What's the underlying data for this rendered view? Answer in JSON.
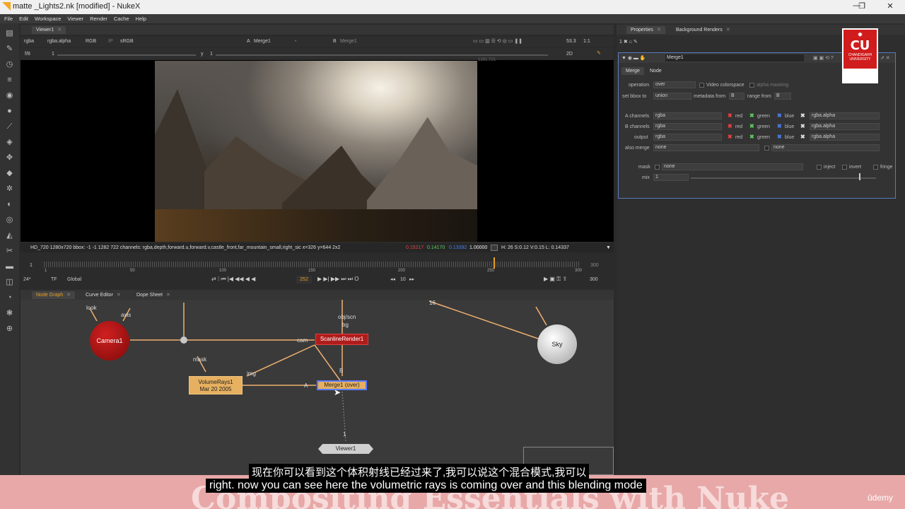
{
  "window": {
    "title": "matte _Lights2.nk [modified] - NukeX",
    "controls": [
      "—",
      "❐",
      "✕"
    ]
  },
  "menubar": [
    "File",
    "Edit",
    "Workspace",
    "Viewer",
    "Render",
    "Cache",
    "Help"
  ],
  "viewer": {
    "tab": "Viewer1",
    "channels": "rgba",
    "alpha": "rgba.alpha",
    "colorspace_mode": "RGB",
    "ip": "IP",
    "lut": "sRGB",
    "a_label": "A",
    "a_input": "Merge1",
    "a_op": "-",
    "b_label": "B",
    "b_input": "Merge1",
    "zoom": "53.3",
    "ratio": "1:1",
    "fstop": "f/8",
    "gain": "1",
    "y_label": "y",
    "gamma": "1",
    "view_mode": "2D",
    "corner_label": "1281,721",
    "info_format": "HD_720 1280x720",
    "info_bbox": "bbox: -1 -1 1282 722 channels: rgba,depth,forward.u,forward.v,castle_front,far_mountain_small,right_sic",
    "info_coords": "x=326 y=644 2x2",
    "info_r": "0.15217",
    "info_g": "0.14170",
    "info_b": "0.13392",
    "info_a": "1.00000",
    "info_hsv": "H: 26 S:0.12 V:0.15  L: 0.14337",
    "color_r": "#e84040",
    "color_g": "#5ec85e",
    "color_b": "#4a7de8"
  },
  "timeline": {
    "start": "1",
    "end": "300",
    "end2": "300",
    "current_frame": "252",
    "ticks": [
      "1",
      "50",
      "100",
      "150",
      "200",
      "250",
      "300"
    ],
    "fps": "24*",
    "tf": "TF",
    "range_mode": "Global",
    "step": "10",
    "playhead_fraction": 0.84
  },
  "nodegraph": {
    "tabs": [
      "Node Graph",
      "Curve Editor",
      "Dope Sheet"
    ],
    "nodes": {
      "camera": "Camera1",
      "sky": "Sky",
      "scanline": "ScanlineRender1",
      "volumerays_name": "VolumeRays1",
      "volumerays_date": "Mar 20 2005",
      "merge": "Merge1 (over)",
      "viewer": "Viewer1"
    },
    "labels": {
      "look": "look",
      "axis": "axis",
      "obj_scn": "obj/scn",
      "bg": "bg",
      "cam": "cam",
      "mask": "mask",
      "img": "img",
      "a_input": "A",
      "b_input": "B",
      "viewer_input": "1",
      "sky_input": "16"
    }
  },
  "properties": {
    "tabs": [
      "Properties",
      "Background Renders"
    ],
    "node_name": "Merge1",
    "subtabs": [
      "Merge",
      "Node"
    ],
    "operation_label": "operation",
    "operation_value": "over",
    "video_colorspace": "Video colorspace",
    "alpha_masking": "alpha masking",
    "bbox_label": "set bbox to",
    "bbox_value": "union",
    "metadata_label": "metadata from",
    "metadata_value": "B",
    "range_label": "range from",
    "range_value": "B",
    "a_channels_label": "A channels",
    "b_channels_label": "B channels",
    "output_label": "output",
    "also_merge_label": "also merge",
    "channel_value": "rgba",
    "alpha_value": "rgba.alpha",
    "none_value": "none",
    "red": "red",
    "green": "green",
    "blue": "blue",
    "mask_label": "mask",
    "mask_value": "none",
    "inject": "inject",
    "invert": "invert",
    "fringe": "fringe",
    "mix_label": "mix",
    "mix_value": "1"
  },
  "logo": {
    "text": "CU",
    "line1": "CHANDIGARH",
    "line2": "UNIVERSITY"
  },
  "subtitles": {
    "background_title": "Compositing Essentials with Nuke",
    "chinese": "现在你可以看到这个体积射线已经过来了,我可以说这个混合模式,我可以",
    "english": "right. now you can see here the volumetric rays is coming over and this blending mode",
    "brand": "ûdemy"
  }
}
